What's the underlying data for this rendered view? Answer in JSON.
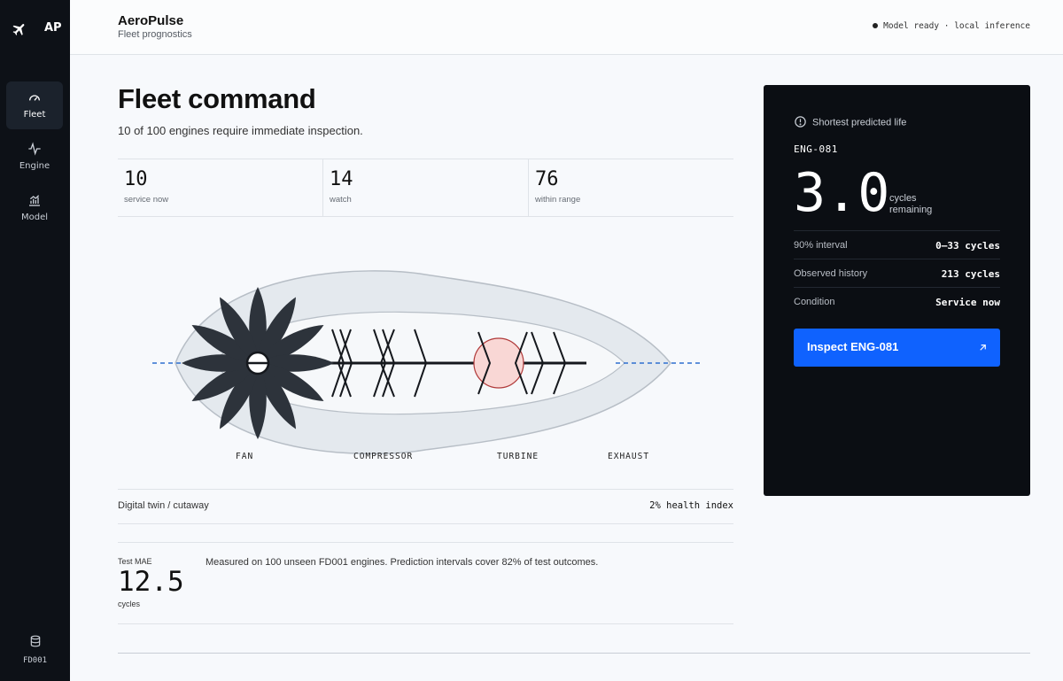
{
  "brand": {
    "short": "AP"
  },
  "nav": [
    {
      "label": "Fleet",
      "icon": "gauge-icon",
      "active": true
    },
    {
      "label": "Engine",
      "icon": "pulse-icon",
      "active": false
    },
    {
      "label": "Model",
      "icon": "chart-icon",
      "active": false
    }
  ],
  "dataset": {
    "label": "FD001",
    "icon": "database-icon"
  },
  "header": {
    "title": "AeroPulse",
    "subtitle": "Fleet prognostics",
    "status": "Model ready · local inference"
  },
  "main": {
    "title": "Fleet command",
    "subtitle": "10 of 100 engines require immediate inspection.",
    "stats": [
      {
        "value": "10",
        "label": "service now"
      },
      {
        "value": "14",
        "label": "watch"
      },
      {
        "value": "76",
        "label": "within range"
      }
    ],
    "engine_sections": [
      "FAN",
      "COMPRESSOR",
      "TURBINE",
      "EXHAUST"
    ],
    "twin": {
      "label": "Digital twin / cutaway",
      "health": "2% health index"
    },
    "mae": {
      "label": "Test MAE",
      "value": "12.5",
      "unit": "cycles",
      "description": "Measured on 100 unseen FD001 engines. Prediction intervals cover 82% of test outcomes."
    }
  },
  "card": {
    "heading": "Shortest predicted life",
    "engine_id": "ENG-081",
    "cycles": "3.0",
    "cycles_unit_line1": "cycles",
    "cycles_unit_line2": "remaining",
    "rows": [
      {
        "key": "90% interval",
        "value": "0–33 cycles"
      },
      {
        "key": "Observed history",
        "value": "213 cycles"
      },
      {
        "key": "Condition",
        "value": "Service now"
      }
    ],
    "button_label": "Inspect ENG-081"
  },
  "colors": {
    "sidebar": "#0d1117",
    "card": "#0b0e13",
    "accent": "#0f62fe",
    "turbine_alert": "#f9d7d5"
  }
}
